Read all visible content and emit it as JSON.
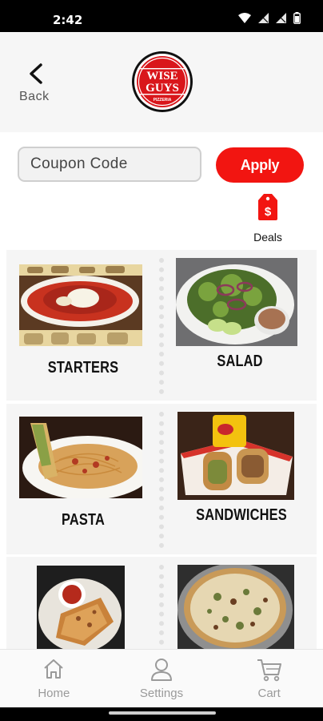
{
  "status_bar": {
    "time": "2:42"
  },
  "header": {
    "back_label": "Back",
    "logo_text_top": "WISE",
    "logo_text_bottom": "GUYS",
    "logo_sub": "PIZZERIA"
  },
  "coupon": {
    "placeholder": "Coupon Code",
    "apply_label": "Apply"
  },
  "deals": {
    "label": "Deals"
  },
  "categories": [
    {
      "label": "STARTERS"
    },
    {
      "label": "SALAD"
    },
    {
      "label": "PASTA"
    },
    {
      "label": "SANDWICHES"
    },
    {
      "label": ""
    },
    {
      "label": ""
    }
  ],
  "tabbar": {
    "home": "Home",
    "settings": "Settings",
    "cart": "Cart"
  },
  "colors": {
    "accent": "#f21511",
    "tab_inactive": "#9a9a9a"
  }
}
